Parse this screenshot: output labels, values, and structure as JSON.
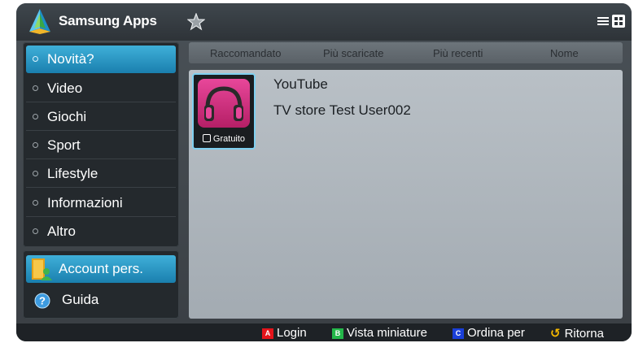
{
  "header": {
    "app_title": "Samsung Apps",
    "logo_icon": "samsung-apps-logo",
    "favorites_icon": "star-icon",
    "view_icons": [
      "list-view-icon",
      "grid-view-icon"
    ]
  },
  "sidebar": {
    "categories": [
      {
        "label": "Novità?",
        "active": true
      },
      {
        "label": "Video",
        "active": false
      },
      {
        "label": "Giochi",
        "active": false
      },
      {
        "label": "Sport",
        "active": false
      },
      {
        "label": "Lifestyle",
        "active": false
      },
      {
        "label": "Informazioni",
        "active": false
      },
      {
        "label": "Altro",
        "active": false
      }
    ],
    "account_label": "Account pers.",
    "help_label": "Guida"
  },
  "sort_tabs": [
    "Raccomandato",
    "Più scaricate",
    "Più recenti",
    "Nome"
  ],
  "selected_app": {
    "name": "YouTube",
    "seller": "TV store Test User002",
    "price_label": "Gratuito",
    "icon": "headphones-icon"
  },
  "footer": {
    "hints": [
      {
        "key": "A",
        "key_color": "#e5141b",
        "label": "Login"
      },
      {
        "key": "B",
        "key_color": "#24b84a",
        "label": "Vista miniature"
      },
      {
        "key": "C",
        "key_color": "#1a3fd8",
        "label": "Ordina per"
      },
      {
        "key": "return",
        "key_color": "#f5b800",
        "label": "Ritorna"
      }
    ]
  },
  "colors": {
    "accent": "#2a9ccc",
    "panel": "#24292d",
    "content_bg": "#b0b8be"
  }
}
